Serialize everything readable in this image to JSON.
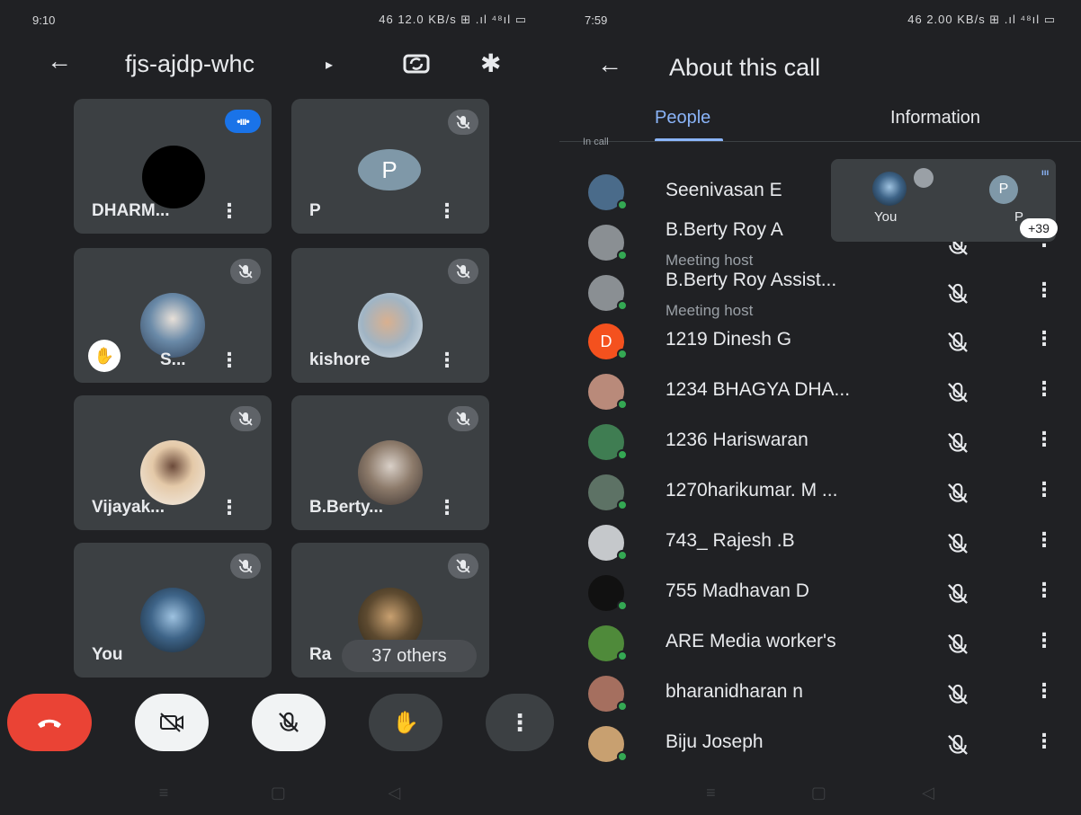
{
  "left": {
    "status": {
      "time": "9:10",
      "right": "46 12.0 KB/s ⊞ .ıl ⁴⁸ıl ▭"
    },
    "meeting_code": "fjs-ajdp-whc",
    "tiles": [
      {
        "name": "DHARM...",
        "state": "speaking"
      },
      {
        "name": "P",
        "state": "muted",
        "initial": "P"
      },
      {
        "name": "S...",
        "state": "muted",
        "hand_raised": true
      },
      {
        "name": "kishore",
        "state": "muted"
      },
      {
        "name": "Vijayak...",
        "state": "muted"
      },
      {
        "name": "B.Berty...",
        "state": "muted"
      },
      {
        "name": "You",
        "state": "muted"
      },
      {
        "name": "Ra",
        "state": "muted"
      }
    ],
    "others_label": "37 others"
  },
  "right": {
    "status": {
      "time": "7:59",
      "right": "46 2.00 KB/s ⊞ .ıl ⁴⁸ıl ▭"
    },
    "title": "About this call",
    "tabs": {
      "people": "People",
      "information": "Information"
    },
    "section_label": "In call",
    "participants": [
      {
        "name": "Seenivasan E",
        "subtitle": "",
        "avatar_color": "#4a6b8a"
      },
      {
        "name": "B.Berty Roy A",
        "subtitle": "Meeting host",
        "avatar_color": "#8a8f93"
      },
      {
        "name": "B.Berty Roy Assist...",
        "subtitle": "Meeting host",
        "avatar_color": "#8a8f93"
      },
      {
        "name": "1219 Dinesh G",
        "subtitle": "",
        "avatar_color": "#f4511e",
        "initial": "D"
      },
      {
        "name": "1234 BHAGYA DHA...",
        "subtitle": "",
        "avatar_color": "#b98a7a"
      },
      {
        "name": "1236 Hariswaran",
        "subtitle": "",
        "avatar_color": "#3f7d52"
      },
      {
        "name": "1270harikumar. M ...",
        "subtitle": "",
        "avatar_color": "#5d7265"
      },
      {
        "name": "743_ Rajesh .B",
        "subtitle": "",
        "avatar_color": "#c5c8cb"
      },
      {
        "name": "755 Madhavan D",
        "subtitle": "",
        "avatar_color": "#111111"
      },
      {
        "name": "ARE Media worker's",
        "subtitle": "",
        "avatar_color": "#4f8a3a"
      },
      {
        "name": "bharanidharan n",
        "subtitle": "",
        "avatar_color": "#a56f5f"
      },
      {
        "name": "Biju Joseph",
        "subtitle": "",
        "avatar_color": "#c8a070"
      }
    ],
    "pip": {
      "you_label": "You",
      "p_label": "P",
      "p_initial": "P",
      "count": "+39"
    }
  },
  "colors": {
    "bg": "#202124",
    "tile": "#3c4043",
    "accent": "#8ab4f8",
    "end_call": "#ea4335",
    "online": "#34a853"
  }
}
